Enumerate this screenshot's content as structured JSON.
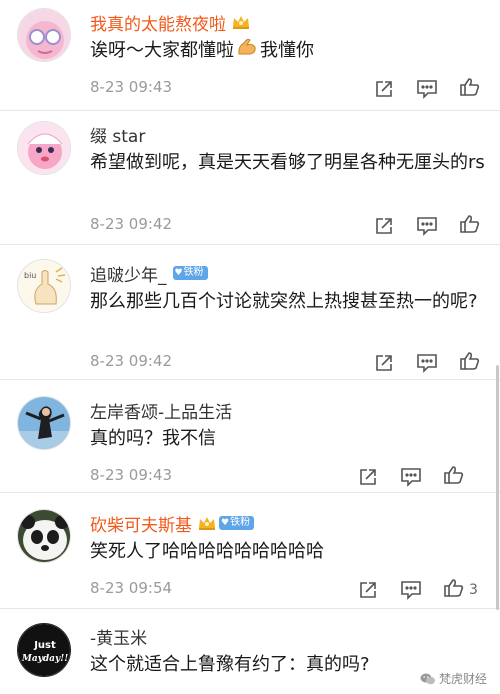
{
  "comments": [
    {
      "username": "我真的太能熬夜啦",
      "name_style": "vip",
      "badge": "",
      "text": "诶呀～大家都懂啦",
      "text_after": "我懂你",
      "time": "8-23 09:43",
      "likes": ""
    },
    {
      "username": "缀 star",
      "name_style": "plain",
      "badge": "",
      "text": "希望做到呢，真是天天看够了明星各种无厘头的rs",
      "time": "8-23 09:42",
      "likes": ""
    },
    {
      "username": "追啵少年_",
      "name_style": "plain",
      "badge": "铁粉",
      "text": "那么那些几百个讨论就突然上热搜甚至热一的呢?",
      "time": "8-23 09:42",
      "likes": ""
    },
    {
      "username": "左岸香颂-上品生活",
      "name_style": "plain",
      "badge": "",
      "text": "真的吗？我不信",
      "time": "8-23 09:43",
      "likes": ""
    },
    {
      "username": "砍柴可夫斯基",
      "name_style": "vip",
      "badge": "铁粉",
      "text": "笑死人了哈哈哈哈哈哈哈哈哈",
      "time": "8-23 09:54",
      "likes": "3"
    },
    {
      "username": "-黄玉米",
      "name_style": "plain",
      "badge": "",
      "text": "这个就适合上鲁豫有约了：真的吗?",
      "time": "",
      "likes": ""
    }
  ],
  "avatars": {
    "avatar_5_text_1": "Just",
    "avatar_5_text_2": "Mayday!!"
  },
  "watermark": {
    "text": "梵虎财经"
  },
  "colors": {
    "vip_name": "#f25a1a",
    "badge": "#5fa6e8",
    "time": "#9a9a9a",
    "icon": "#555555"
  },
  "icons": [
    "share-icon",
    "comment-icon",
    "like-icon",
    "crown-icon",
    "flex-arm-emoji"
  ]
}
